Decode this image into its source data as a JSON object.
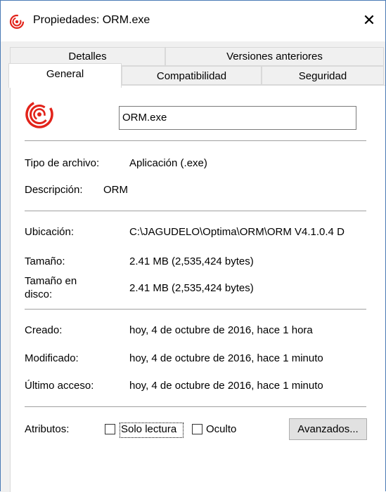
{
  "window": {
    "title": "Propiedades: ORM.exe",
    "close_label": "✕"
  },
  "tabs": {
    "detalles": "Detalles",
    "versiones": "Versiones anteriores",
    "general": "General",
    "compatibilidad": "Compatibilidad",
    "seguridad": "Seguridad",
    "active": "General"
  },
  "general": {
    "file_name": "ORM.exe",
    "tipo_label": "Tipo de archivo:",
    "tipo_value": "Aplicación (.exe)",
    "descripcion_label": "Descripción:",
    "descripcion_value": "ORM",
    "ubicacion_label": "Ubicación:",
    "ubicacion_value": "C:\\JAGUDELO\\Optima\\ORM\\ORM V4.1.0.4 D",
    "tamano_label": "Tamaño:",
    "tamano_value": "2.41 MB (2,535,424 bytes)",
    "tamano_disco_label_1": "Tamaño en",
    "tamano_disco_label_2": "disco:",
    "tamano_disco_value": "2.41 MB (2,535,424 bytes)",
    "creado_label": "Creado:",
    "creado_value": "hoy, 4 de octubre de 2016, hace 1 hora",
    "modificado_label": "Modificado:",
    "modificado_value": "hoy, 4 de octubre de 2016, hace 1 minuto",
    "acceso_label": "Último acceso:",
    "acceso_value": "hoy, 4 de octubre de 2016, hace 1 minuto",
    "atributos_label": "Atributos:",
    "solo_lectura_label": "Solo lectura",
    "solo_lectura_checked": false,
    "oculto_label": "Oculto",
    "oculto_checked": false,
    "avanzados_label": "Avanzados...",
    "app_icon": "orm-red-swirl-icon"
  },
  "colors": {
    "icon_red": "#e2231a",
    "window_border": "#4a7ab5"
  }
}
